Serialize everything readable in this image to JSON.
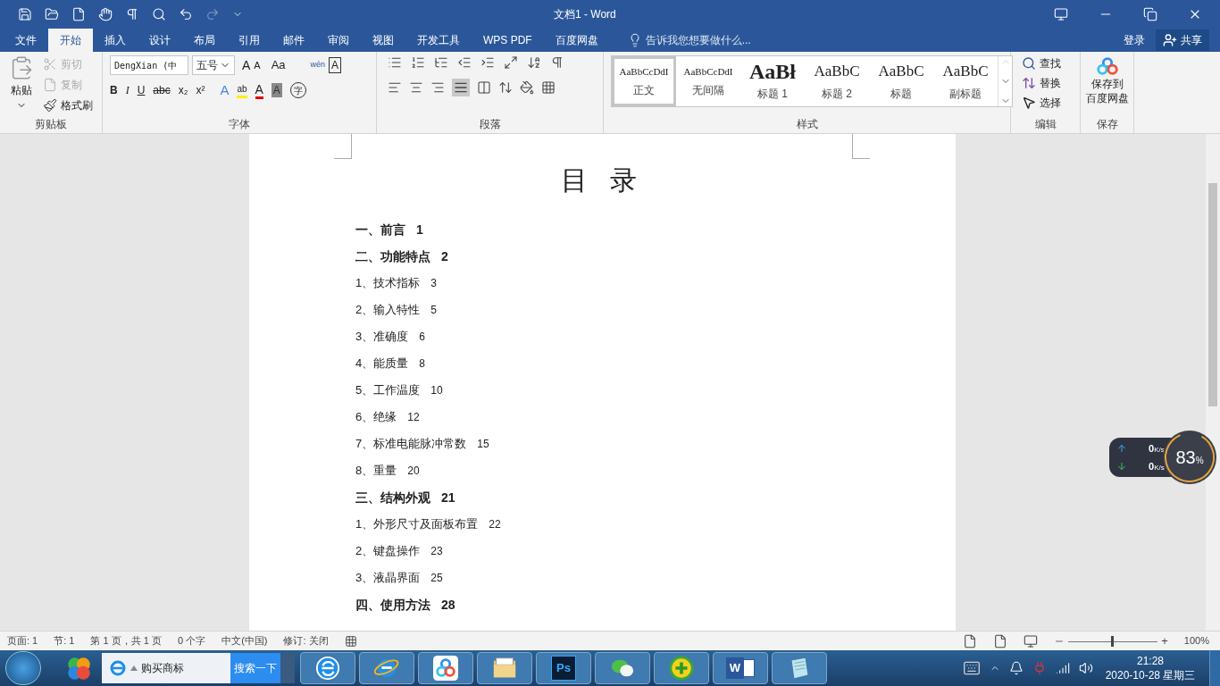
{
  "window": {
    "title": "文档1 - Word"
  },
  "tabs": [
    {
      "label": "文件",
      "selected": false
    },
    {
      "label": "开始",
      "selected": true
    },
    {
      "label": "插入",
      "selected": false
    },
    {
      "label": "设计",
      "selected": false
    },
    {
      "label": "布局",
      "selected": false
    },
    {
      "label": "引用",
      "selected": false
    },
    {
      "label": "邮件",
      "selected": false
    },
    {
      "label": "审阅",
      "selected": false
    },
    {
      "label": "视图",
      "selected": false
    },
    {
      "label": "开发工具",
      "selected": false
    },
    {
      "label": "WPS PDF",
      "selected": false
    },
    {
      "label": "百度网盘",
      "selected": false
    }
  ],
  "tell_me": {
    "placeholder": "告诉我您想要做什么..."
  },
  "account": {
    "login": "登录",
    "share": "共享"
  },
  "clipboard": {
    "paste": "粘贴",
    "cut": {
      "label": "剪切",
      "disabled": true
    },
    "copy": {
      "label": "复制",
      "disabled": true
    },
    "format_painter": {
      "label": "格式刷",
      "disabled": false
    },
    "group_label": "剪贴板"
  },
  "font": {
    "font_name": "DengXian (中",
    "font_size": "五号",
    "tool_glyphs": [
      "A",
      "A",
      "Aa",
      "wén",
      "A"
    ],
    "format_buttons": [
      "B",
      "I",
      "U",
      "abc",
      "x₂",
      "x²"
    ],
    "effect_glyphs": [
      "A",
      "ab",
      "A",
      "A",
      "字"
    ],
    "group_label": "字体"
  },
  "paragraph": {
    "group_label": "段落"
  },
  "styles": {
    "items": [
      {
        "preview": "AaBbCcDdI",
        "name": "正文",
        "kind": "body",
        "selected": true
      },
      {
        "preview": "AaBbCcDdI",
        "name": "无间隔",
        "kind": "body",
        "selected": false
      },
      {
        "preview": "AaBł",
        "name": "标题 1",
        "kind": "heading1",
        "selected": false
      },
      {
        "preview": "AaBbC",
        "name": "标题 2",
        "kind": "heading2",
        "selected": false
      },
      {
        "preview": "AaBbC",
        "name": "标题",
        "kind": "heading2",
        "selected": false
      },
      {
        "preview": "AaBbC",
        "name": "副标题",
        "kind": "heading2",
        "selected": false
      }
    ],
    "group_label": "样式"
  },
  "editing": {
    "find": "查找",
    "replace": "替换",
    "select": "选择",
    "group_label": "编辑"
  },
  "save": {
    "button_line1": "保存到",
    "button_line2": "百度网盘",
    "group_label": "保存"
  },
  "document": {
    "heading": "目 录",
    "toc": [
      {
        "text": "一、前言",
        "page": "1",
        "kind": "chapter"
      },
      {
        "text": "二、功能特点",
        "page": "2",
        "kind": "chapter"
      },
      {
        "text": "1、技术指标",
        "page": "3",
        "kind": "section"
      },
      {
        "text": "2、输入特性",
        "page": "5",
        "kind": "section"
      },
      {
        "text": "3、准确度",
        "page": "6",
        "kind": "section"
      },
      {
        "text": "4、能质量",
        "page": "8",
        "kind": "section"
      },
      {
        "text": "5、工作温度",
        "page": "10",
        "kind": "section"
      },
      {
        "text": "6、绝缘",
        "page": "12",
        "kind": "section"
      },
      {
        "text": "7、标准电能脉冲常数",
        "page": "15",
        "kind": "section"
      },
      {
        "text": "8、重量",
        "page": "20",
        "kind": "section"
      },
      {
        "text": "三、结构外观",
        "page": "21",
        "kind": "chapter"
      },
      {
        "text": "1、外形尺寸及面板布置",
        "page": "22",
        "kind": "section"
      },
      {
        "text": "2、键盘操作",
        "page": "23",
        "kind": "section"
      },
      {
        "text": "3、液晶界面",
        "page": "25",
        "kind": "section"
      },
      {
        "text": "四、使用方法",
        "page": "28",
        "kind": "chapter"
      }
    ]
  },
  "net_monitor": {
    "upload": "0",
    "upload_unit": "K/s",
    "download": "0",
    "download_unit": "K/s",
    "percent": "83",
    "percent_sign": "%"
  },
  "status_bar": {
    "items": [
      "页面: 1",
      "节: 1",
      "第 1 页，共 1 页",
      "0 个字",
      "中文(中国)",
      "修订: 关闭"
    ],
    "zoom_in": "+",
    "zoom_slider": {
      "level": 0.5
    },
    "zoom": "100%"
  },
  "taskbar": {
    "search": {
      "text": "购买商标",
      "button": "搜索一下"
    },
    "apps": [
      {
        "kind": "browser"
      },
      {
        "kind": "ie"
      },
      {
        "kind": "cloud"
      },
      {
        "kind": "folder"
      },
      {
        "kind": "photoshop",
        "label": "Ps"
      },
      {
        "kind": "chat"
      },
      {
        "kind": "security"
      },
      {
        "kind": "word",
        "label": "W"
      },
      {
        "kind": "notepad"
      }
    ],
    "time": "21:28",
    "date": "2020-10-28 星期三"
  }
}
